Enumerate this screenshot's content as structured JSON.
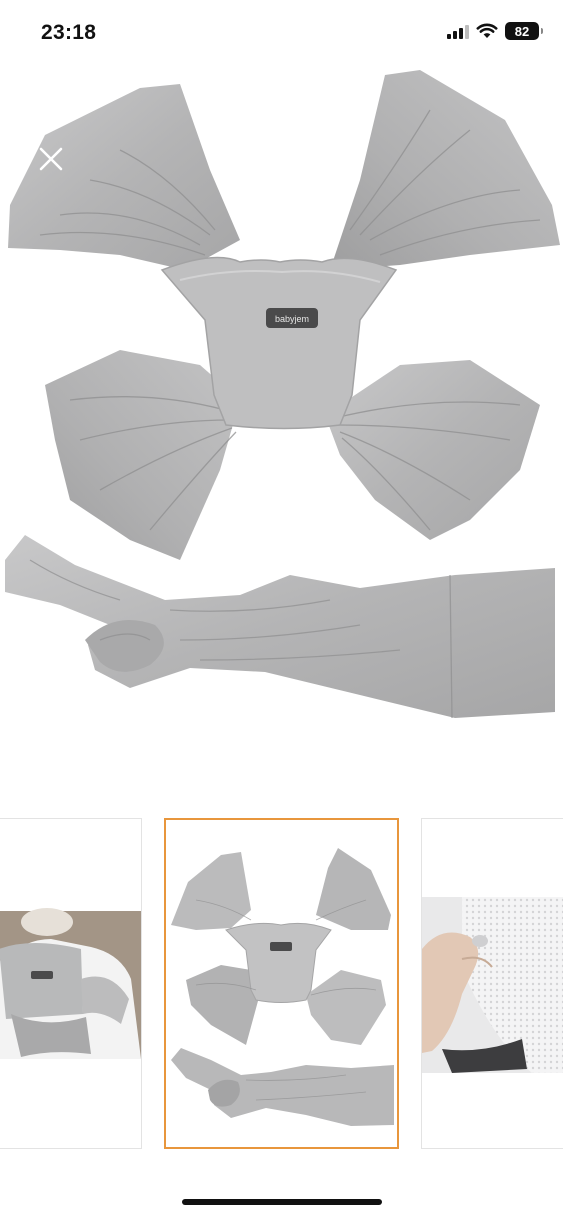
{
  "status_bar": {
    "time": "23:18",
    "battery_level": "82",
    "signal_bars_active": 3,
    "signal_bars_total": 4,
    "icons": [
      "cellular-signal-icon",
      "wifi-icon",
      "battery-icon"
    ]
  },
  "viewer": {
    "close_icon": "close-icon",
    "main_image": "gray-fabric-wrap-baby-carrier-photo",
    "product_logo_text": "babyjem"
  },
  "thumbnails": [
    {
      "name": "thumbnail-worn-back-view",
      "selected": false
    },
    {
      "name": "thumbnail-carrier-flat-lay",
      "selected": true
    },
    {
      "name": "thumbnail-mesh-fabric-closeup",
      "selected": false
    }
  ],
  "colors": {
    "selected_border": "#e8963c",
    "fabric_gray": "#b9b9ba",
    "status_text": "#111111"
  }
}
